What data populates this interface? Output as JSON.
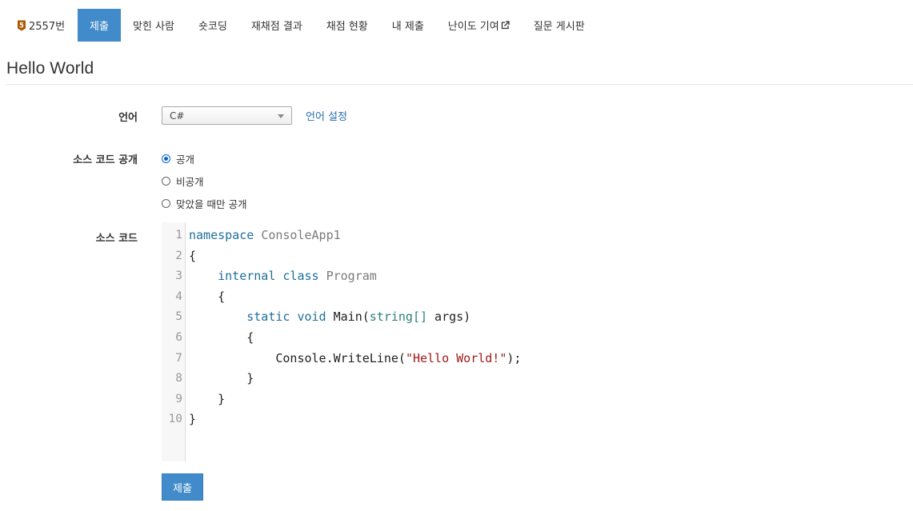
{
  "nav": {
    "problem_number": "2557번",
    "tier_badge_text": "5",
    "tier_color": "#ad5600",
    "items": [
      {
        "label": "제출"
      },
      {
        "label": "맞힌 사람"
      },
      {
        "label": "숏코딩"
      },
      {
        "label": "재채점 결과"
      },
      {
        "label": "채점 현황"
      },
      {
        "label": "내 제출"
      },
      {
        "label": "난이도 기여"
      },
      {
        "label": "질문 게시판"
      }
    ],
    "active_label": "제출",
    "external_icon": "external-link-icon"
  },
  "title": "Hello World",
  "form": {
    "language_label": "언어",
    "language_value": "C#",
    "language_setting_link": "언어 설정",
    "visibility_label": "소스 코드 공개",
    "visibility_options": [
      "공개",
      "비공개",
      "맞았을 때만 공개"
    ],
    "visibility_selected": "공개",
    "source_label": "소스 코드",
    "submit_label": "제출"
  },
  "code": {
    "line_numbers": [
      "1",
      "2",
      "3",
      "4",
      "5",
      "6",
      "7",
      "8",
      "9",
      "10"
    ],
    "lines": [
      [
        {
          "t": "namespace",
          "c": "kw"
        },
        {
          "t": " ",
          "c": ""
        },
        {
          "t": "ConsoleApp1",
          "c": "ty"
        }
      ],
      [
        {
          "t": "{",
          "c": ""
        }
      ],
      [
        {
          "t": "    ",
          "c": ""
        },
        {
          "t": "internal",
          "c": "kw"
        },
        {
          "t": " ",
          "c": ""
        },
        {
          "t": "class",
          "c": "kw"
        },
        {
          "t": " ",
          "c": ""
        },
        {
          "t": "Program",
          "c": "ty"
        }
      ],
      [
        {
          "t": "    {",
          "c": ""
        }
      ],
      [
        {
          "t": "        ",
          "c": ""
        },
        {
          "t": "static",
          "c": "kw"
        },
        {
          "t": " ",
          "c": ""
        },
        {
          "t": "void",
          "c": "kw"
        },
        {
          "t": " Main(",
          "c": ""
        },
        {
          "t": "string[]",
          "c": "gt"
        },
        {
          "t": " args)",
          "c": ""
        }
      ],
      [
        {
          "t": "        {",
          "c": ""
        }
      ],
      [
        {
          "t": "            Console.WriteLine(",
          "c": ""
        },
        {
          "t": "\"Hello World!\"",
          "c": "st"
        },
        {
          "t": ");",
          "c": ""
        }
      ],
      [
        {
          "t": "        }",
          "c": ""
        }
      ],
      [
        {
          "t": "    }",
          "c": ""
        }
      ],
      [
        {
          "t": "}",
          "c": ""
        }
      ]
    ],
    "colors": {
      "keyword": "#1f6f99",
      "type": "#7a7a7a",
      "generic": "#2b7f7a",
      "string": "#a11a1a"
    }
  },
  "colors": {
    "accent": "#428bca",
    "link": "#2a6fad"
  }
}
